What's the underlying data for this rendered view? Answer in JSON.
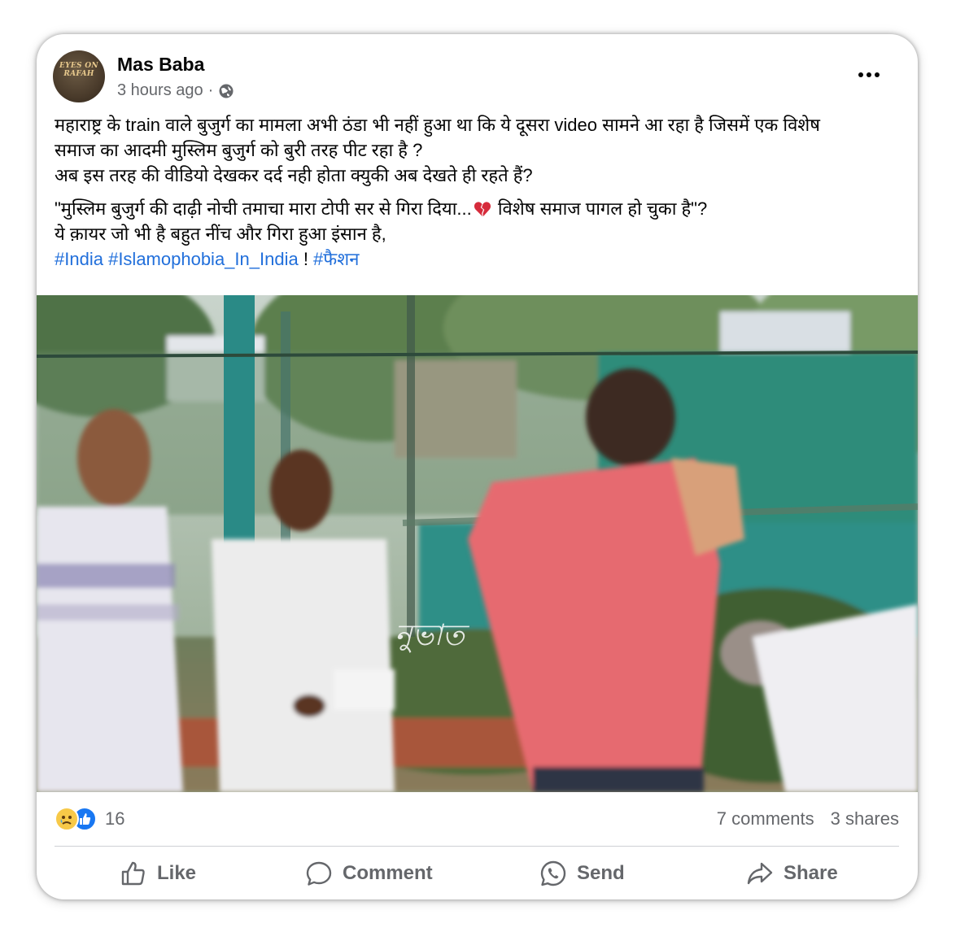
{
  "post": {
    "author": "Mas Baba",
    "timestamp": "3 hours ago",
    "separator": "·",
    "privacy_icon": "globe-icon",
    "avatar_text": "EYES ON RAFAH",
    "more_icon": "more-options-icon",
    "text": {
      "line1": "महाराष्ट्र के train वाले बुजुर्ग का मामला अभी ठंडा भी नहीं हुआ था कि ये दूसरा video सामने आ रहा है जिसमें एक विशेष",
      "line2": "समाज का आदमी मुस्लिम बुजुर्ग को बुरी तरह पीट रहा है ?",
      "line3": "अब इस तरह की वीडियो देखकर दर्द नही होता क्युकी अब देखते ही रहते हैं?",
      "quote_part1": "\"मुस्लिम बुजुर्ग की दाढ़ी नोची तमाचा मारा टोपी सर से गिरा दिया...",
      "quote_emoji": "broken-heart-icon",
      "quote_part2": " विशेष समाज पागल हो चुका है\"?",
      "line5": "ये क़ायर जो भी है बहुत नींच और गिरा हुआ इंसान है,",
      "hashtag1": "#India",
      "hashtag2": "#Islamophobia_In_India",
      "exclaim": " ! ",
      "hashtag3": "#फैशन"
    },
    "video_watermark": "নুভাত"
  },
  "stats": {
    "reaction_icons": [
      "sad-reaction-icon",
      "like-reaction-icon"
    ],
    "reaction_count": "16",
    "comments": "7 comments",
    "shares": "3 shares"
  },
  "actions": {
    "like": "Like",
    "comment": "Comment",
    "send": "Send",
    "share": "Share"
  },
  "colors": {
    "hashtag": "#216fdb",
    "secondary_text": "#65676b",
    "like_blue": "#1877f2"
  }
}
